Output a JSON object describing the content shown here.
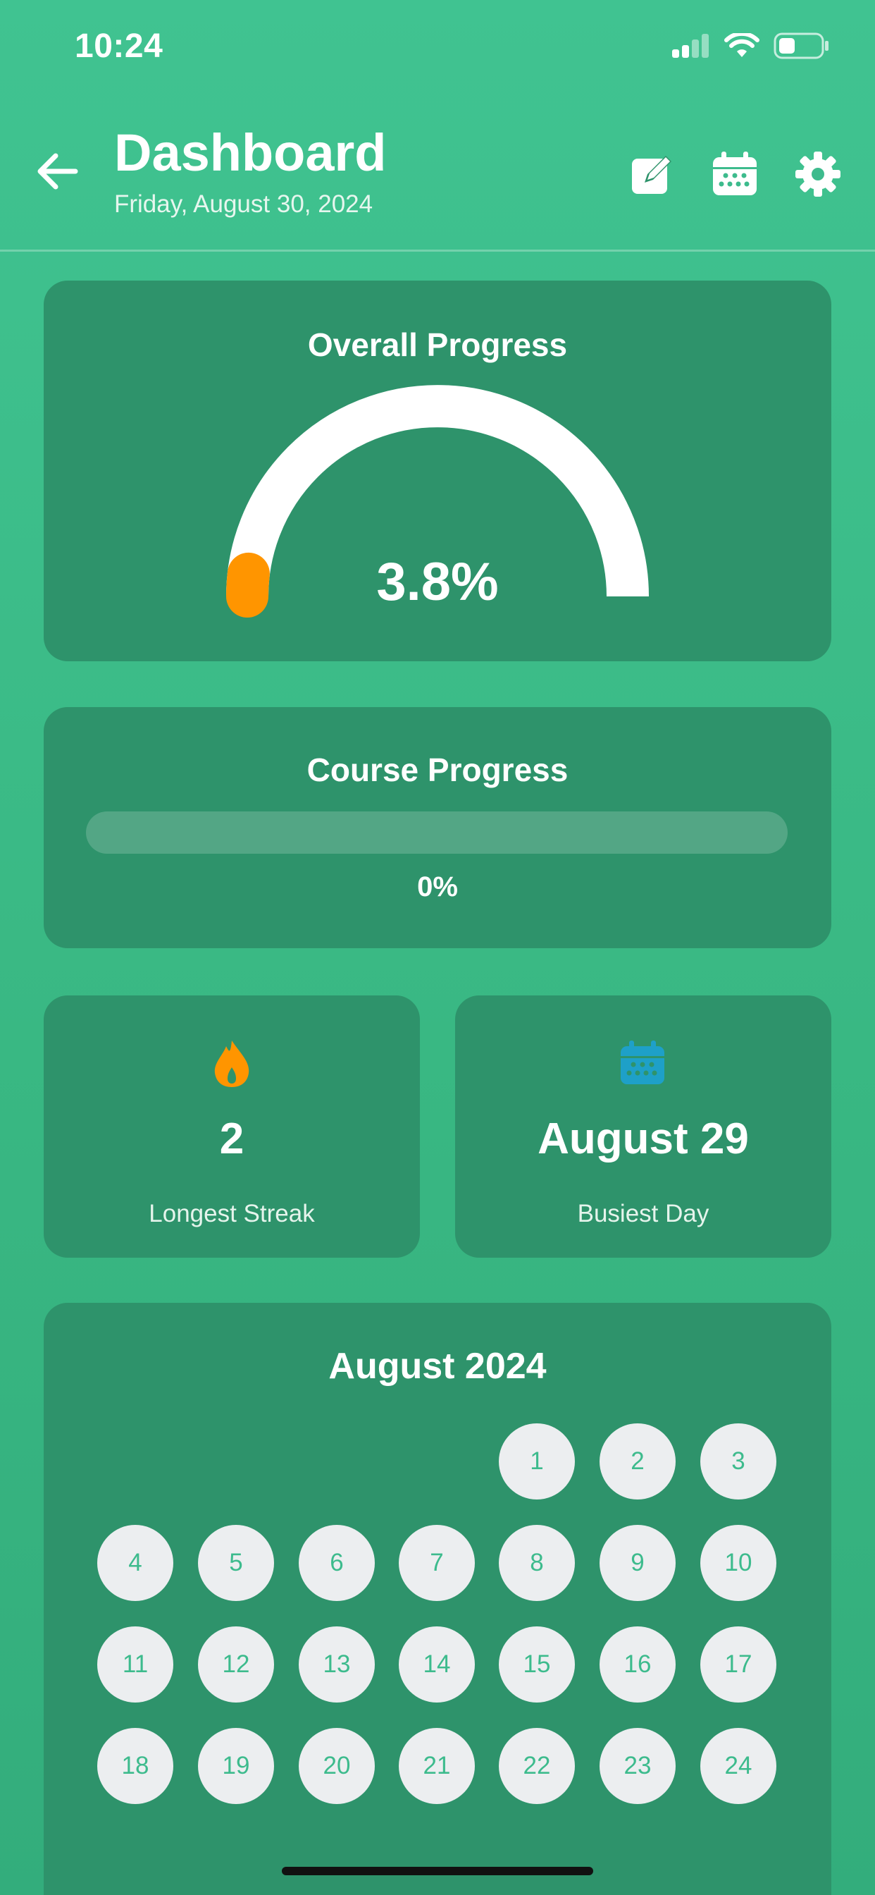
{
  "status_bar": {
    "time": "10:24",
    "icons": [
      "signal-icon",
      "wifi-icon",
      "battery-icon"
    ]
  },
  "header": {
    "title": "Dashboard",
    "date": "Friday, August 30, 2024",
    "buttons": [
      "back-arrow-icon",
      "edit-icon",
      "calendar-icon",
      "gear-icon"
    ]
  },
  "overall_progress": {
    "title": "Overall Progress",
    "value_text": "3.8%",
    "value": 3.8,
    "colors": {
      "track": "#FFFFFF",
      "indicator": "#FF9500"
    }
  },
  "course_progress": {
    "title": "Course Progress",
    "value_text": "0%",
    "value": 0
  },
  "stats": {
    "streak": {
      "icon": "flame-icon",
      "value": "2",
      "label": "Longest Streak",
      "icon_color": "#FF9500"
    },
    "busiest": {
      "icon": "calendar-icon",
      "value": "August 29",
      "label": "Busiest Day",
      "icon_color": "#1EA0C8"
    }
  },
  "calendar": {
    "title": "August 2024",
    "first_weekday_index": 4,
    "visible_days": [
      "1",
      "2",
      "3",
      "4",
      "5",
      "6",
      "7",
      "8",
      "9",
      "10",
      "11",
      "12",
      "13",
      "14",
      "15",
      "16",
      "17",
      "18",
      "19",
      "20",
      "21",
      "22",
      "23",
      "24"
    ]
  },
  "colors": {
    "background": "#3DBB8D",
    "card": "#2E936B",
    "day_circle": "#ECEEF0",
    "day_text": "#3DBB8D"
  }
}
